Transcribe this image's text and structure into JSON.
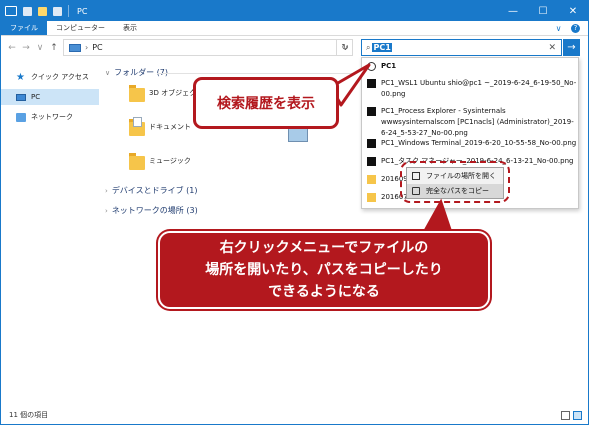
{
  "titlebar": {
    "title": "PC",
    "minimize": "—",
    "maximize": "☐",
    "close": "✕"
  },
  "ribbon": {
    "tabs": [
      {
        "label": "ファイル",
        "active": true
      },
      {
        "label": "コンピューター",
        "active": false
      },
      {
        "label": "表示",
        "active": false
      }
    ],
    "expand_icon": "chevron-down-icon",
    "help": "?"
  },
  "address": {
    "back": "←",
    "forward": "→",
    "recent": "∨",
    "up": "↑",
    "separator": "›",
    "location": "PC",
    "dropdown": "∨",
    "refresh": "↻"
  },
  "search": {
    "magnifier": "⌕",
    "query": "PC1",
    "clear": "✕",
    "go": "→"
  },
  "navpane": {
    "items": [
      {
        "label": "クイック アクセス",
        "icon": "star-icon",
        "selected": false
      },
      {
        "label": "PC",
        "icon": "pc-icon",
        "selected": true
      },
      {
        "label": "ネットワーク",
        "icon": "network-icon",
        "selected": false
      }
    ]
  },
  "content": {
    "groups": {
      "folders": "フォルダー (7)",
      "devices": "デバイスとドライブ (1)",
      "network": "ネットワークの場所 (3)"
    },
    "folders": [
      {
        "label": "3D オブジェクト"
      },
      {
        "label": "ドキュメント"
      },
      {
        "label": "ミュージック"
      }
    ]
  },
  "dropdown": {
    "history_label": "PC1",
    "items": [
      {
        "text": "PC1_WSL1 Ubuntu shio@pc1 ~_2019-6-24_6-19-50_No-00.png",
        "bold_prefix": "PC1",
        "icon": "image-file-icon"
      },
      {
        "text": "PC1_Process Explorer - Sysinternals wwwsysinternalscom [PC1nacls] (Administrator)_2019-6-24_5-53-27_No-00.png",
        "bold_prefix": "PC1",
        "icon": "image-file-icon"
      },
      {
        "text": "PC1_Windows Terminal_2019-6-20_10-55-58_No-00.png",
        "bold_prefix": "PC1",
        "icon": "image-file-icon"
      },
      {
        "text": "PC1_タスク マネージャー_2019-6-24_6-13-21_No-00.png",
        "bold_prefix": "PC1",
        "icon": "image-file-icon"
      },
      {
        "text": "201609",
        "icon": "folder-icon"
      },
      {
        "text": "201607",
        "icon": "folder-icon"
      }
    ]
  },
  "context_menu": {
    "items": [
      {
        "label": "ファイルの場所を開く",
        "hover": false
      },
      {
        "label": "完全なパスをコピー",
        "hover": true
      }
    ]
  },
  "callouts": {
    "top": "検索履歴を表示",
    "bottom": "右クリックメニューでファイルの\n場所を開いたり、パスをコピーしたり\nできるようになる"
  },
  "status": {
    "count": "11 個の項目"
  },
  "colors": {
    "accent": "#1979ca",
    "callout_red": "#b3181e",
    "selection": "#cce4f7",
    "folder_yellow": "#f6c54a"
  }
}
